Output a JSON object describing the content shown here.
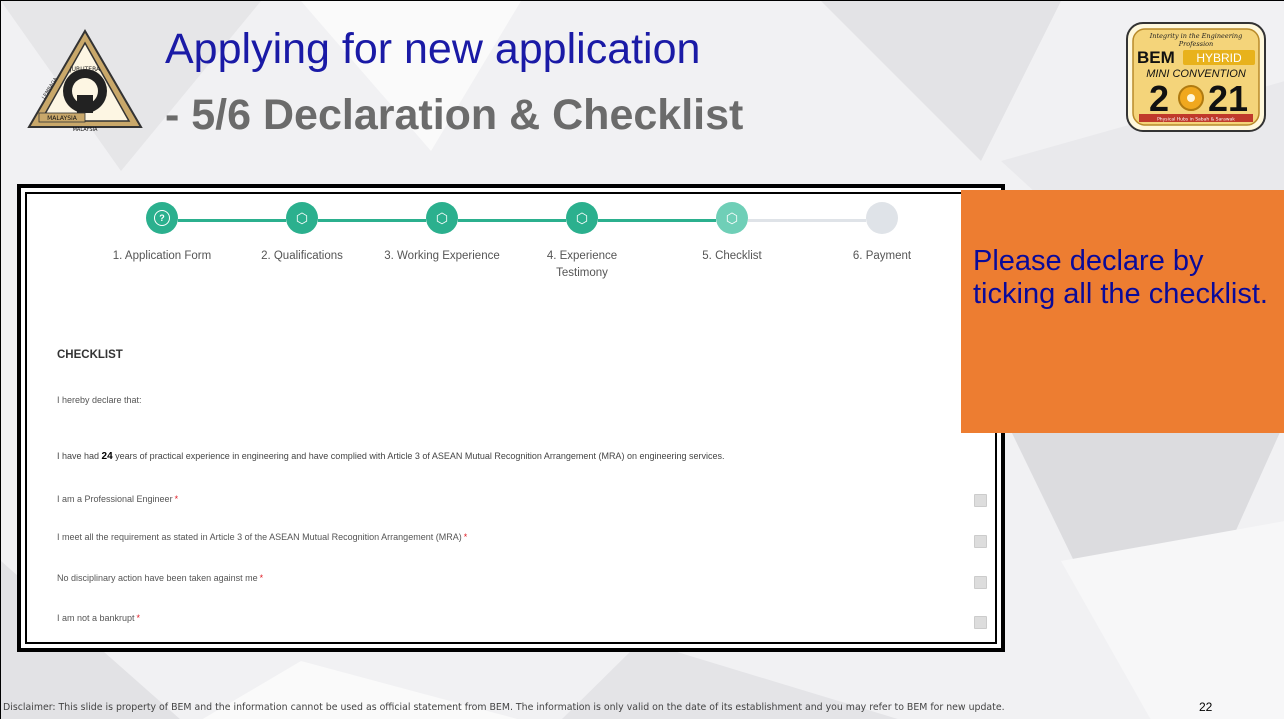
{
  "slide": {
    "title": "Applying for new application",
    "subtitle": "- 5/6 Declaration & Checklist",
    "page_number": "22",
    "disclaimer": "Disclaimer: This slide is property of BEM and the information cannot be used as official statement from BEM. The information is only valid on the date of its establishment and you may refer to BEM for new update."
  },
  "logo_left": {
    "arc_top": "JURUTERA",
    "arc_left": "LEMBAGA",
    "band": "MALAYSIA",
    "bottom": "MALAYSIA"
  },
  "logo_right": {
    "tagline_1": "Integrity in the Engineering",
    "tagline_2": "Profession",
    "brand": "BEM",
    "hybrid": "HYBRID",
    "event": "MINI CONVENTION",
    "year_left": "2",
    "year_right": "21",
    "footer": "Physical Hubs in Sabah & Sarawak"
  },
  "stepper": {
    "colors": {
      "done": "#2bb08e",
      "current": "#6fcfb7",
      "pending": "#dfe3e8"
    },
    "steps": [
      {
        "label": "1. Application Form",
        "state": "done",
        "icon": "question-icon"
      },
      {
        "label": "2. Qualifications",
        "state": "done",
        "icon": "cube-icon"
      },
      {
        "label": "3. Working Experience",
        "state": "done",
        "icon": "cube-icon"
      },
      {
        "label": "4. Experience\nTestimony",
        "state": "done",
        "icon": "cube-icon"
      },
      {
        "label": "5. Checklist",
        "state": "current",
        "icon": "cube-icon"
      },
      {
        "label": "6. Payment",
        "state": "pending",
        "icon": "circle-icon"
      }
    ]
  },
  "checklist": {
    "title": "CHECKLIST",
    "intro": "I hereby declare that:",
    "experience": {
      "before": "I have had ",
      "years": "24",
      "after": " years of practical experience in engineering and have complied with Article 3 of ASEAN Mutual Recognition Arrangement (MRA) on engineering services."
    },
    "required_mark": "*",
    "items": [
      {
        "text": "I am a Professional Engineer",
        "checked": false
      },
      {
        "text": "I meet all the requirement as stated in Article 3 of the ASEAN Mutual Recognition Arrangement (MRA)",
        "checked": false
      },
      {
        "text": "No disciplinary action have been taken against me",
        "checked": false
      },
      {
        "text": "I am not a bankrupt",
        "checked": false
      }
    ]
  },
  "callout": {
    "text": "Please declare by ticking all the checklist.",
    "color": "#ed7d31"
  }
}
